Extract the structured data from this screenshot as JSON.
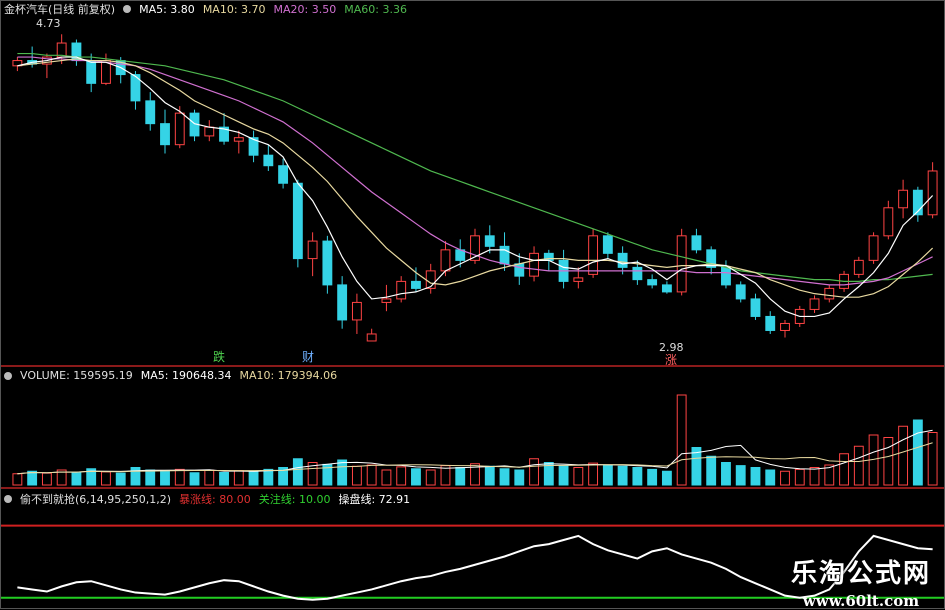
{
  "colors": {
    "up": "#ff4444",
    "down": "#35d3e6",
    "ma5": "#ffffff",
    "ma10": "#e8d9a0",
    "ma20": "#d070d0",
    "ma60": "#4fb84f",
    "separator": "#8b1a1a",
    "red_line": "#d02020",
    "green_line": "#22cc22"
  },
  "price_panel": {
    "stock": "金杯汽车(日线 前复权)",
    "ma5_label": "MA5: 3.80",
    "ma10_label": "MA10: 3.70",
    "ma20_label": "MA20: 3.50",
    "ma60_label": "MA60: 3.36",
    "high_label": "4.73",
    "low_label": "2.98",
    "marker_1": "跌",
    "marker_2": "财",
    "marker_3": "涨"
  },
  "volume_panel": {
    "volume_label": "VOLUME: 159595.19",
    "ma5_label": "MA5: 190648.34",
    "ma10_label": "MA10: 179394.06"
  },
  "indicator_panel": {
    "name": "偷不到就抢(6,14,95,250,1,2)",
    "line1_label": "暴涨线: 80.00",
    "line2_label": "关注线: 10.00",
    "line3_label": "操盘线: 72.91"
  },
  "watermark": {
    "cn": "乐淘公式网",
    "url": "www.60lt.com"
  },
  "chart_data": [
    {
      "type": "candlestick",
      "series_name": "金杯汽车",
      "y_range": [
        2.9,
        4.8
      ],
      "candles": [
        [
          4.55,
          4.6,
          4.52,
          4.58
        ],
        [
          4.58,
          4.66,
          4.54,
          4.56
        ],
        [
          4.56,
          4.62,
          4.48,
          4.6
        ],
        [
          4.6,
          4.73,
          4.56,
          4.68
        ],
        [
          4.68,
          4.7,
          4.55,
          4.58
        ],
        [
          4.58,
          4.62,
          4.4,
          4.45
        ],
        [
          4.45,
          4.62,
          4.44,
          4.58
        ],
        [
          4.58,
          4.6,
          4.45,
          4.5
        ],
        [
          4.5,
          4.52,
          4.3,
          4.35
        ],
        [
          4.35,
          4.4,
          4.18,
          4.22
        ],
        [
          4.22,
          4.3,
          4.05,
          4.1
        ],
        [
          4.1,
          4.32,
          4.08,
          4.28
        ],
        [
          4.28,
          4.3,
          4.12,
          4.15
        ],
        [
          4.15,
          4.24,
          4.12,
          4.2
        ],
        [
          4.2,
          4.28,
          4.1,
          4.12
        ],
        [
          4.12,
          4.18,
          4.05,
          4.14
        ],
        [
          4.14,
          4.18,
          4.0,
          4.04
        ],
        [
          4.04,
          4.1,
          3.95,
          3.98
        ],
        [
          3.98,
          4.02,
          3.85,
          3.88
        ],
        [
          3.88,
          3.9,
          3.4,
          3.45
        ],
        [
          3.45,
          3.6,
          3.35,
          3.55
        ],
        [
          3.55,
          3.58,
          3.25,
          3.3
        ],
        [
          3.3,
          3.35,
          3.05,
          3.1
        ],
        [
          3.1,
          3.25,
          3.02,
          3.2
        ],
        [
          2.98,
          3.05,
          2.98,
          3.02
        ],
        [
          3.2,
          3.3,
          3.15,
          3.22
        ],
        [
          3.22,
          3.35,
          3.2,
          3.32
        ],
        [
          3.32,
          3.4,
          3.26,
          3.28
        ],
        [
          3.28,
          3.42,
          3.25,
          3.38
        ],
        [
          3.38,
          3.55,
          3.35,
          3.5
        ],
        [
          3.5,
          3.56,
          3.4,
          3.44
        ],
        [
          3.44,
          3.62,
          3.42,
          3.58
        ],
        [
          3.58,
          3.64,
          3.48,
          3.52
        ],
        [
          3.52,
          3.6,
          3.38,
          3.42
        ],
        [
          3.42,
          3.48,
          3.3,
          3.35
        ],
        [
          3.35,
          3.52,
          3.32,
          3.48
        ],
        [
          3.48,
          3.5,
          3.38,
          3.44
        ],
        [
          3.44,
          3.5,
          3.28,
          3.32
        ],
        [
          3.32,
          3.4,
          3.28,
          3.34
        ],
        [
          3.36,
          3.62,
          3.34,
          3.58
        ],
        [
          3.58,
          3.6,
          3.45,
          3.48
        ],
        [
          3.48,
          3.52,
          3.36,
          3.4
        ],
        [
          3.4,
          3.44,
          3.3,
          3.33
        ],
        [
          3.33,
          3.36,
          3.28,
          3.3
        ],
        [
          3.3,
          3.32,
          3.25,
          3.26
        ],
        [
          3.26,
          3.62,
          3.24,
          3.58
        ],
        [
          3.58,
          3.62,
          3.48,
          3.5
        ],
        [
          3.5,
          3.52,
          3.36,
          3.4
        ],
        [
          3.4,
          3.44,
          3.28,
          3.3
        ],
        [
          3.3,
          3.32,
          3.2,
          3.22
        ],
        [
          3.22,
          3.25,
          3.1,
          3.12
        ],
        [
          3.12,
          3.15,
          3.02,
          3.04
        ],
        [
          3.04,
          3.1,
          3.0,
          3.08
        ],
        [
          3.08,
          3.18,
          3.06,
          3.16
        ],
        [
          3.16,
          3.24,
          3.14,
          3.22
        ],
        [
          3.22,
          3.3,
          3.2,
          3.28
        ],
        [
          3.28,
          3.38,
          3.26,
          3.36
        ],
        [
          3.36,
          3.46,
          3.34,
          3.44
        ],
        [
          3.44,
          3.6,
          3.42,
          3.58
        ],
        [
          3.58,
          3.78,
          3.56,
          3.74
        ],
        [
          3.74,
          3.9,
          3.68,
          3.84
        ],
        [
          3.84,
          3.86,
          3.66,
          3.7
        ],
        [
          3.7,
          4.0,
          3.68,
          3.95
        ]
      ],
      "ma5": [
        4.55,
        4.57,
        4.58,
        4.6,
        4.6,
        4.57,
        4.57,
        4.54,
        4.49,
        4.42,
        4.34,
        4.29,
        4.22,
        4.2,
        4.19,
        4.17,
        4.13,
        4.1,
        4.03,
        3.88,
        3.78,
        3.63,
        3.46,
        3.32,
        3.22,
        3.23,
        3.25,
        3.26,
        3.29,
        3.38,
        3.42,
        3.46,
        3.5,
        3.5,
        3.46,
        3.44,
        3.44,
        3.4,
        3.39,
        3.43,
        3.45,
        3.42,
        3.43,
        3.39,
        3.33,
        3.39,
        3.41,
        3.41,
        3.41,
        3.36,
        3.31,
        3.22,
        3.15,
        3.12,
        3.12,
        3.14,
        3.22,
        3.29,
        3.37,
        3.48,
        3.64,
        3.72,
        3.81
      ],
      "ma10": [
        4.55,
        4.56,
        4.57,
        4.58,
        4.59,
        4.58,
        4.58,
        4.57,
        4.55,
        4.51,
        4.46,
        4.41,
        4.35,
        4.31,
        4.27,
        4.23,
        4.19,
        4.16,
        4.11,
        4.04,
        3.97,
        3.89,
        3.79,
        3.69,
        3.6,
        3.51,
        3.44,
        3.37,
        3.31,
        3.3,
        3.32,
        3.35,
        3.38,
        3.4,
        3.42,
        3.44,
        3.45,
        3.45,
        3.44,
        3.44,
        3.44,
        3.43,
        3.42,
        3.41,
        3.4,
        3.41,
        3.41,
        3.42,
        3.41,
        3.39,
        3.37,
        3.33,
        3.3,
        3.27,
        3.25,
        3.24,
        3.23,
        3.23,
        3.25,
        3.29,
        3.36,
        3.43,
        3.51
      ],
      "ma20": [
        4.6,
        4.6,
        4.59,
        4.59,
        4.58,
        4.58,
        4.57,
        4.56,
        4.55,
        4.53,
        4.5,
        4.47,
        4.44,
        4.41,
        4.38,
        4.35,
        4.31,
        4.27,
        4.23,
        4.17,
        4.11,
        4.04,
        3.97,
        3.9,
        3.83,
        3.77,
        3.71,
        3.65,
        3.59,
        3.54,
        3.5,
        3.47,
        3.44,
        3.42,
        3.4,
        3.39,
        3.38,
        3.38,
        3.38,
        3.38,
        3.38,
        3.38,
        3.38,
        3.38,
        3.38,
        3.38,
        3.37,
        3.37,
        3.37,
        3.36,
        3.35,
        3.34,
        3.33,
        3.32,
        3.31,
        3.3,
        3.3,
        3.31,
        3.32,
        3.34,
        3.38,
        3.42,
        3.46
      ],
      "ma60": [
        4.62,
        4.62,
        4.61,
        4.61,
        4.6,
        4.6,
        4.59,
        4.58,
        4.57,
        4.56,
        4.55,
        4.53,
        4.51,
        4.49,
        4.47,
        4.44,
        4.41,
        4.38,
        4.35,
        4.31,
        4.27,
        4.23,
        4.19,
        4.15,
        4.11,
        4.07,
        4.03,
        3.99,
        3.95,
        3.92,
        3.89,
        3.86,
        3.83,
        3.8,
        3.77,
        3.74,
        3.71,
        3.68,
        3.65,
        3.62,
        3.59,
        3.56,
        3.53,
        3.5,
        3.48,
        3.46,
        3.44,
        3.42,
        3.4,
        3.38,
        3.37,
        3.36,
        3.35,
        3.34,
        3.33,
        3.33,
        3.32,
        3.32,
        3.33,
        3.33,
        3.34,
        3.35,
        3.36
      ]
    },
    {
      "type": "bar",
      "series_name": "VOLUME",
      "y_range": [
        0,
        800000
      ],
      "values": [
        90000,
        110000,
        95000,
        120000,
        100000,
        130000,
        105000,
        95000,
        140000,
        120000,
        110000,
        125000,
        98000,
        118000,
        100000,
        115000,
        108000,
        125000,
        140000,
        210000,
        180000,
        165000,
        200000,
        150000,
        160000,
        120000,
        145000,
        130000,
        120000,
        155000,
        140000,
        170000,
        150000,
        130000,
        120000,
        210000,
        180000,
        155000,
        140000,
        175000,
        160000,
        150000,
        140000,
        125000,
        110000,
        720000,
        300000,
        230000,
        180000,
        155000,
        140000,
        120000,
        110000,
        125000,
        140000,
        160000,
        250000,
        310000,
        400000,
        380000,
        470000,
        520000,
        420000
      ],
      "ma5": [
        90000,
        100000,
        98000,
        104000,
        103000,
        111000,
        110000,
        109000,
        114000,
        118000,
        118000,
        119000,
        119000,
        122000,
        111000,
        111000,
        109000,
        114000,
        117000,
        139000,
        154000,
        166000,
        179000,
        181000,
        175000,
        159000,
        157000,
        145000,
        141000,
        134000,
        138000,
        143000,
        147000,
        153000,
        142000,
        162000,
        170000,
        167000,
        161000,
        164000,
        162000,
        160000,
        154000,
        150000,
        137000,
        250000,
        259000,
        277000,
        308000,
        317000,
        201000,
        165000,
        141000,
        130000,
        127000,
        139000,
        177000,
        217000,
        263000,
        300000,
        362000,
        416000,
        438000
      ],
      "ma10": [
        90000,
        100000,
        98000,
        104000,
        103000,
        109000,
        107000,
        106000,
        110000,
        111000,
        113000,
        115000,
        116000,
        116000,
        116000,
        115000,
        115000,
        117000,
        117000,
        125000,
        132000,
        138000,
        146000,
        149000,
        157000,
        158000,
        161000,
        162000,
        161000,
        157000,
        155000,
        155000,
        149000,
        146000,
        142000,
        150000,
        156000,
        157000,
        158000,
        160000,
        162000,
        163000,
        161000,
        155000,
        152000,
        202000,
        214000,
        222000,
        226000,
        224000,
        222000,
        211000,
        209000,
        219000,
        220000,
        193000,
        188000,
        188000,
        205000,
        228000,
        264000,
        301000,
        338000
      ]
    },
    {
      "type": "line",
      "series_name": "操盘线",
      "y_range": [
        0,
        100
      ],
      "reference_lines": [
        80,
        10
      ],
      "values": [
        20,
        18,
        16,
        21,
        25,
        26,
        22,
        18,
        15,
        14,
        13,
        16,
        20,
        24,
        27,
        26,
        21,
        16,
        12,
        9,
        8,
        9,
        12,
        15,
        18,
        22,
        26,
        29,
        31,
        35,
        38,
        42,
        46,
        50,
        55,
        60,
        62,
        66,
        70,
        62,
        56,
        52,
        48,
        55,
        58,
        52,
        48,
        44,
        38,
        30,
        24,
        18,
        12,
        10,
        12,
        18,
        35,
        55,
        70,
        66,
        62,
        58,
        57
      ]
    }
  ]
}
